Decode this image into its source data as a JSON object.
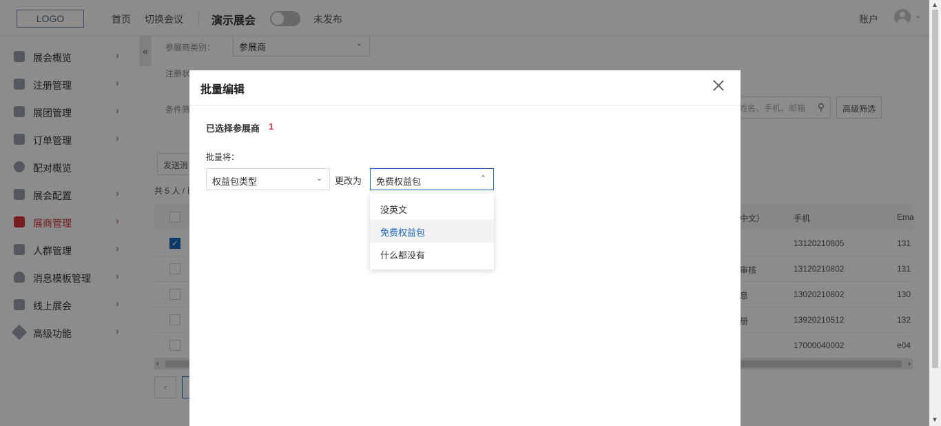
{
  "header": {
    "logo": "LOGO",
    "nav_home": "首页",
    "nav_switch": "切换会议",
    "event_title": "演示展会",
    "publish_status": "未发布",
    "account": "账户"
  },
  "sidebar": {
    "items": [
      {
        "label": "展会概览",
        "icon": "overview-icon",
        "has_arrow": true
      },
      {
        "label": "注册管理",
        "icon": "registration-icon",
        "has_arrow": true
      },
      {
        "label": "展团管理",
        "icon": "group-icon",
        "has_arrow": true
      },
      {
        "label": "订单管理",
        "icon": "order-icon",
        "has_arrow": true
      },
      {
        "label": "配对概览",
        "icon": "matching-icon",
        "has_arrow": false
      },
      {
        "label": "展会配置",
        "icon": "config-icon",
        "has_arrow": true
      },
      {
        "label": "展商管理",
        "icon": "exhibitor-icon",
        "has_arrow": true,
        "active": true
      },
      {
        "label": "人群管理",
        "icon": "crowd-icon",
        "has_arrow": true
      },
      {
        "label": "消息模板管理",
        "icon": "bell-icon",
        "has_arrow": true
      },
      {
        "label": "线上展会",
        "icon": "online-icon",
        "has_arrow": true
      },
      {
        "label": "高级功能",
        "icon": "tag-icon",
        "has_arrow": true
      }
    ],
    "collapse": "«"
  },
  "background": {
    "category_label": "参展商类别：",
    "category_value": "参展商",
    "reg_status_label": "注册状",
    "filter_label": "条件筛",
    "search_placeholder": "姓名、手机、邮箱",
    "advanced_filter": "高级筛选",
    "send_button": "发送消",
    "total": "共 5 人 / 已",
    "columns": [
      "中文）",
      "手机",
      "Ema"
    ],
    "rows": [
      {
        "checked": true,
        "status": "",
        "phone": "13120210805",
        "email": "131"
      },
      {
        "checked": false,
        "status": "审核",
        "phone": "13120210802",
        "email": "131"
      },
      {
        "checked": false,
        "status": "息",
        "phone": "13020210802",
        "email": "130"
      },
      {
        "checked": false,
        "status": "册",
        "phone": "13920210512",
        "email": "132"
      },
      {
        "checked": false,
        "status": "",
        "phone": "17000040002",
        "email": "e04"
      }
    ]
  },
  "modal": {
    "title": "批量编辑",
    "selected_label": "已选择参展商",
    "selected_count": "1",
    "batch_label": "批量将：",
    "field_value": "权益包类型",
    "change_to": "更改为",
    "new_value": "免费权益包",
    "options": [
      "没英文",
      "免费权益包",
      "什么都没有"
    ],
    "selected_option_index": 1
  },
  "colors": {
    "accent": "#1a66c0",
    "active_nav": "#d9363e",
    "count": "#d9363e"
  }
}
